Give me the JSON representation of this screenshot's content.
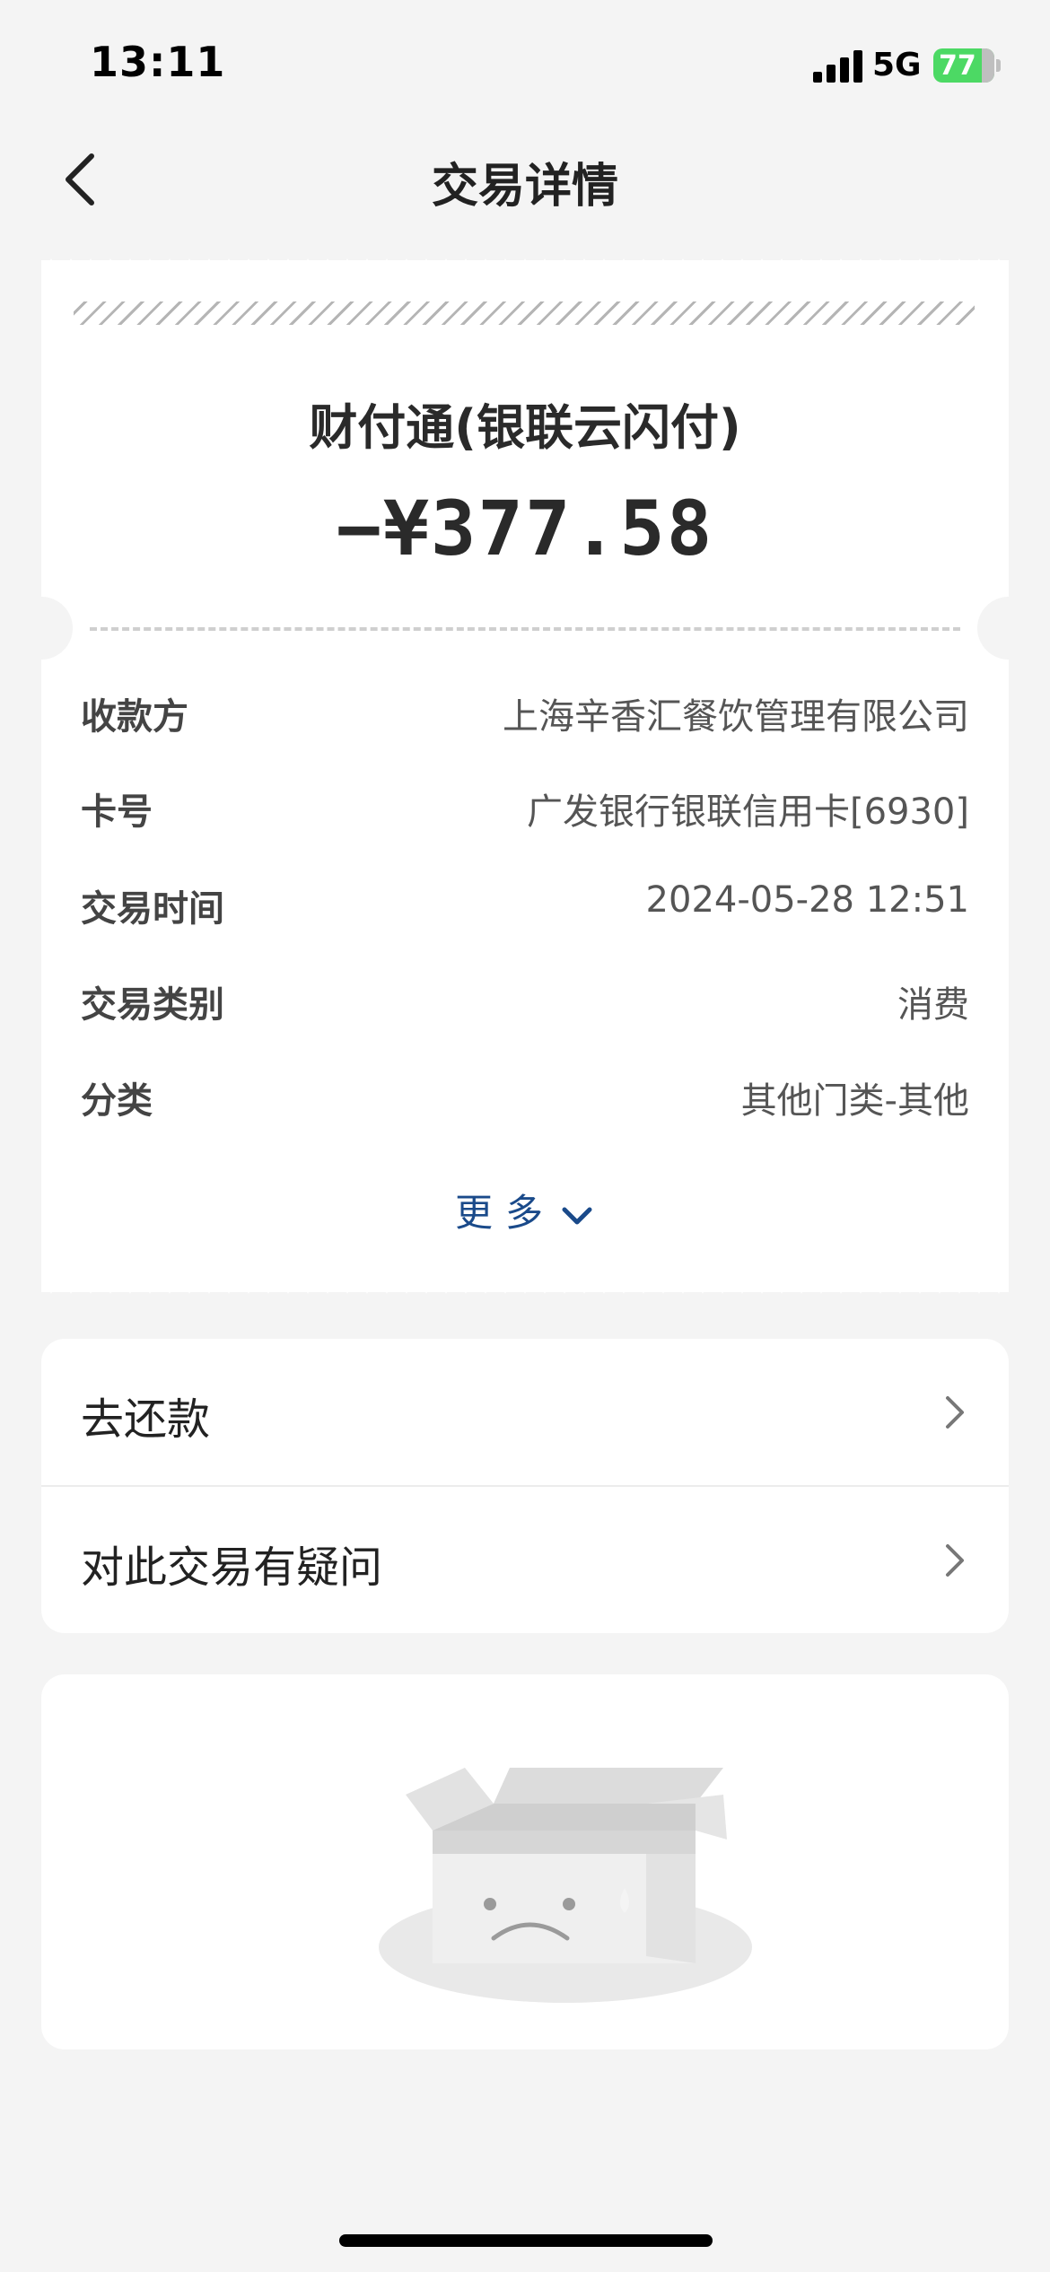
{
  "status_bar": {
    "time": "13:11",
    "network": "5G",
    "battery": "77",
    "battery_level": 0.77,
    "battery_color": "#4cd964"
  },
  "nav": {
    "back_icon": "chevron-left-icon",
    "title": "交易详情"
  },
  "receipt": {
    "merchant": "财付通(银联云闪付)",
    "amount": "−¥377.58",
    "rows": [
      {
        "label": "收款方",
        "value": "上海辛香汇餐饮管理有限公司"
      },
      {
        "label": "卡号",
        "value": "广发银行银联信用卡[6930]"
      },
      {
        "label": "交易时间",
        "value": "2024-05-28 12:51"
      },
      {
        "label": "交易类别",
        "value": "消费"
      },
      {
        "label": "分类",
        "value": "其他门类-其他"
      }
    ],
    "more_label": "更多",
    "more_icon": "chevron-down-icon",
    "accent_color": "#1a4a8a"
  },
  "actions": [
    {
      "label": "去还款",
      "icon": "chevron-right-icon"
    },
    {
      "label": "对此交易有疑问",
      "icon": "chevron-right-icon"
    }
  ],
  "empty_state": {
    "icon": "empty-box-icon"
  }
}
